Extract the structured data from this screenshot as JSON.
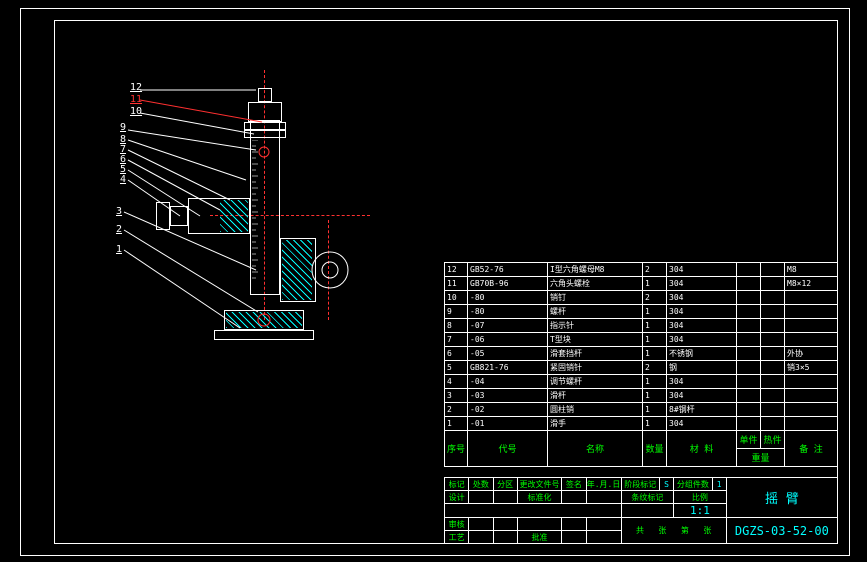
{
  "leaders": {
    "n1": "1",
    "n2": "2",
    "n3": "3",
    "n4": "4",
    "n5": "5",
    "n6": "6",
    "n7": "7",
    "n8": "8",
    "n9": "9",
    "n10": "10",
    "n11": "11",
    "n12": "12"
  },
  "bom_rows": [
    {
      "idx": "12",
      "code": "GB52-76",
      "name": "I型六角螺母M8",
      "qty": "2",
      "mat": "304",
      "wt": "",
      "rem": "M8"
    },
    {
      "idx": "11",
      "code": "GB70B-96",
      "name": "六角头螺栓",
      "qty": "1",
      "mat": "304",
      "wt": "",
      "rem": "M8×12"
    },
    {
      "idx": "10",
      "code": "-80",
      "name": "销钉",
      "qty": "2",
      "mat": "304",
      "wt": "",
      "rem": ""
    },
    {
      "idx": "9",
      "code": "-80",
      "name": "螺杆",
      "qty": "1",
      "mat": "304",
      "wt": "",
      "rem": ""
    },
    {
      "idx": "8",
      "code": "-07",
      "name": "指示针",
      "qty": "1",
      "mat": "304",
      "wt": "",
      "rem": ""
    },
    {
      "idx": "7",
      "code": "-06",
      "name": "T型块",
      "qty": "1",
      "mat": "304",
      "wt": "",
      "rem": ""
    },
    {
      "idx": "6",
      "code": "-05",
      "name": "滑套挡杆",
      "qty": "1",
      "mat": "不锈钢",
      "wt": "",
      "rem": "外协"
    },
    {
      "idx": "5",
      "code": "GB821-76",
      "name": "紧固销针",
      "qty": "2",
      "mat": "钢",
      "wt": "",
      "rem": "销3×5"
    },
    {
      "idx": "4",
      "code": "-04",
      "name": "调节螺杆",
      "qty": "1",
      "mat": "304",
      "wt": "",
      "rem": ""
    },
    {
      "idx": "3",
      "code": "-03",
      "name": "滑杆",
      "qty": "1",
      "mat": "304",
      "wt": "",
      "rem": ""
    },
    {
      "idx": "2",
      "code": "-02",
      "name": "圆柱销",
      "qty": "1",
      "mat": "8#钢杆",
      "wt": "",
      "rem": ""
    },
    {
      "idx": "1",
      "code": "-01",
      "name": "滑手",
      "qty": "1",
      "mat": "304",
      "wt": "",
      "rem": ""
    }
  ],
  "bom_header": {
    "idx": "序号",
    "code": "代号",
    "name": "名称",
    "qty": "数量",
    "mat": "材 料",
    "wt_single": "单件",
    "wt_total": "热件",
    "wt": "重量",
    "rem": "备 注"
  },
  "titleblock": {
    "row_labels": {
      "标记": "标记",
      "处数": "处数",
      "分区": "分区",
      "更改文件号": "更改文件号",
      "签名": "签名",
      "年月日": "年.月.日",
      "设计": "设计",
      "标准化": "标准化",
      "审核": "审核",
      "工艺": "工艺",
      "批准": "批准"
    },
    "阶段标记": "阶段标记",
    "S": "S",
    "分组件数": "分组件数",
    "one": "1",
    "条纹标记": "条纹标记",
    "比例": "比例",
    "scale": "1:1",
    "共": "共",
    "张": "张",
    "第": "第",
    "title": "摇 臂",
    "dwgno": "DGZS-03-52-00"
  }
}
